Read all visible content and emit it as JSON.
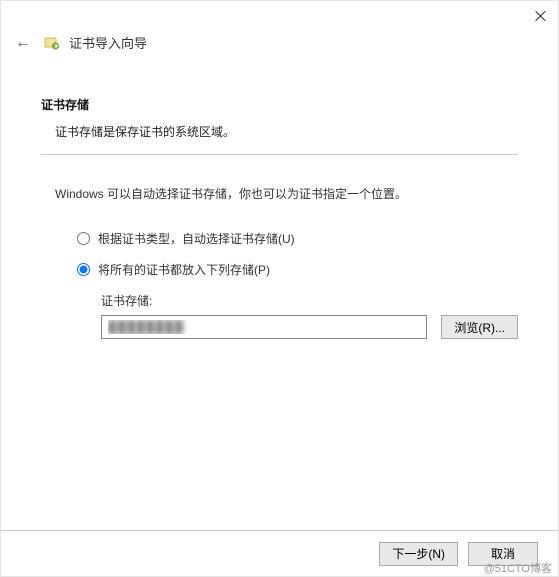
{
  "window": {
    "wizard_title": "证书导入向导"
  },
  "section": {
    "title": "证书存储",
    "description": "证书存储是保存证书的系统区域。"
  },
  "instruction": "Windows 可以自动选择证书存储，你也可以为证书指定一个位置。",
  "radios": {
    "auto": "根据证书类型，自动选择证书存储(U)",
    "manual": "将所有的证书都放入下列存储(P)",
    "selected": "manual"
  },
  "store": {
    "label": "证书存储:",
    "value": "████████"
  },
  "buttons": {
    "browse": "浏览(R)...",
    "next": "下一步(N)",
    "cancel": "取消"
  },
  "watermark": "@51CTO博客"
}
